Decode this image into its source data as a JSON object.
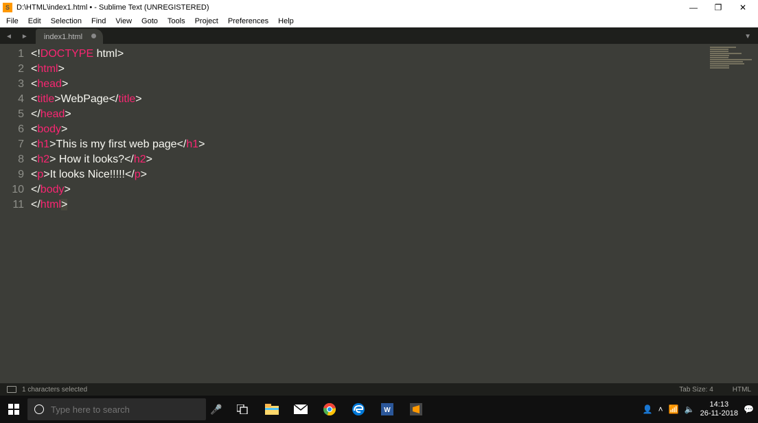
{
  "titlebar": {
    "title": "D:\\HTML\\index1.html • - Sublime Text (UNREGISTERED)",
    "minimize": "—",
    "maximize": "❐",
    "close": "✕"
  },
  "menu": {
    "items": [
      "File",
      "Edit",
      "Selection",
      "Find",
      "View",
      "Goto",
      "Tools",
      "Project",
      "Preferences",
      "Help"
    ]
  },
  "tabs": {
    "active": "index1.html"
  },
  "code": {
    "lines": [
      [
        [
          "punc",
          "<!"
        ],
        [
          "doctype",
          "DOCTYPE"
        ],
        [
          "text",
          " html"
        ],
        [
          "punc",
          ">"
        ]
      ],
      [
        [
          "punc",
          "<"
        ],
        [
          "tag",
          "html"
        ],
        [
          "punc",
          ">"
        ]
      ],
      [
        [
          "punc",
          "<"
        ],
        [
          "tag",
          "head"
        ],
        [
          "punc",
          ">"
        ]
      ],
      [
        [
          "punc",
          "<"
        ],
        [
          "tag",
          "title"
        ],
        [
          "punc",
          ">"
        ],
        [
          "text",
          "WebPage"
        ],
        [
          "punc",
          "</"
        ],
        [
          "tag",
          "title"
        ],
        [
          "punc",
          ">"
        ]
      ],
      [
        [
          "punc",
          "</"
        ],
        [
          "tag",
          "head"
        ],
        [
          "punc",
          ">"
        ]
      ],
      [
        [
          "punc",
          "<"
        ],
        [
          "tag",
          "body"
        ],
        [
          "punc",
          ">"
        ]
      ],
      [
        [
          "punc",
          "<"
        ],
        [
          "tag",
          "h1"
        ],
        [
          "punc",
          ">"
        ],
        [
          "text",
          "This is my first web page"
        ],
        [
          "punc",
          "</"
        ],
        [
          "tag",
          "h1"
        ],
        [
          "punc",
          ">"
        ]
      ],
      [
        [
          "punc",
          "<"
        ],
        [
          "tag",
          "h2"
        ],
        [
          "punc",
          ">"
        ],
        [
          "text",
          " How it looks?"
        ],
        [
          "punc",
          "</"
        ],
        [
          "tag",
          "h2"
        ],
        [
          "punc",
          ">"
        ]
      ],
      [
        [
          "punc",
          "<"
        ],
        [
          "tag",
          "p"
        ],
        [
          "punc",
          ">"
        ],
        [
          "text",
          "It looks Nice!!!!!"
        ],
        [
          "punc",
          "</"
        ],
        [
          "tag",
          "p"
        ],
        [
          "punc",
          ">"
        ]
      ],
      [
        [
          "punc",
          "</"
        ],
        [
          "tag",
          "body"
        ],
        [
          "punc",
          ">"
        ]
      ],
      [
        [
          "punc",
          "</"
        ],
        [
          "tag",
          "html"
        ],
        [
          "cursor",
          ">"
        ]
      ]
    ]
  },
  "status": {
    "selection": "1 characters selected",
    "tabsize": "Tab Size: 4",
    "syntax": "HTML"
  },
  "taskbar": {
    "search_placeholder": "Type here to search",
    "time": "14:13",
    "date": "26-11-2018"
  }
}
